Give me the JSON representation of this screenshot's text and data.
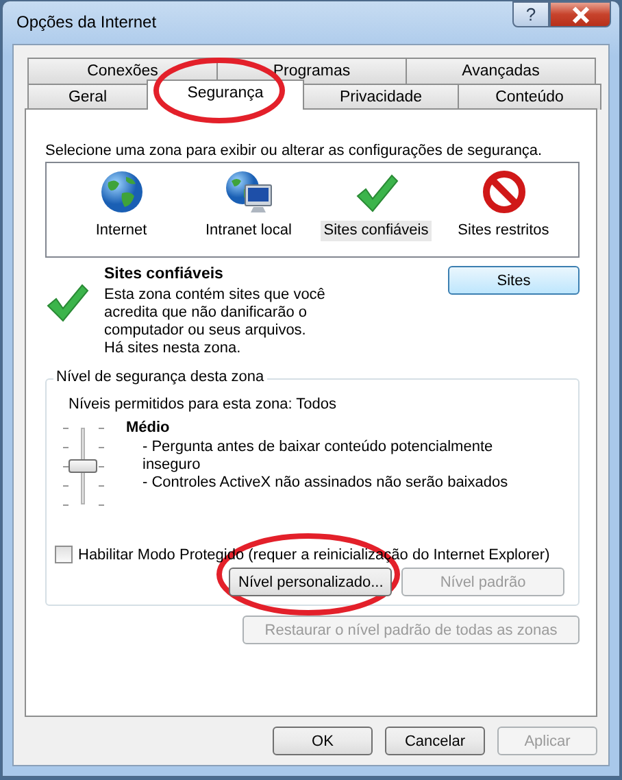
{
  "window": {
    "title": "Opções da Internet",
    "help_label": "?"
  },
  "tab_rows": [
    [
      {
        "label": "Conexões",
        "selected": false
      },
      {
        "label": "Programas",
        "selected": false
      },
      {
        "label": "Avançadas",
        "selected": false
      }
    ],
    [
      {
        "label": "Geral",
        "selected": false
      },
      {
        "label": "Segurança",
        "selected": true
      },
      {
        "label": "Privacidade",
        "selected": false
      },
      {
        "label": "Conteúdo",
        "selected": false
      }
    ]
  ],
  "instruction": "Selecione uma zona para exibir ou alterar as configurações de segurança.",
  "zones": [
    {
      "kind": "globe",
      "label": "Internet",
      "selected": false
    },
    {
      "kind": "intranet",
      "label": "Intranet local",
      "selected": false
    },
    {
      "kind": "trusted",
      "label": "Sites confiáveis",
      "selected": true
    },
    {
      "kind": "restricted",
      "label": "Sites restritos",
      "selected": false
    }
  ],
  "zone_info": {
    "kind": "trusted",
    "title": "Sites confiáveis",
    "description": [
      "Esta zona contém sites que você",
      "acredita que não danificarão o",
      "computador ou seus arquivos.",
      " Há sites nesta zona."
    ],
    "button": "Sites"
  },
  "security_level": {
    "legend": "Nível de segurança desta zona",
    "allowed": "Níveis permitidos para esta zona: Todos",
    "level": 0.5,
    "name": "Médio",
    "details": [
      "- Pergunta antes de baixar conteúdo potencialmente inseguro",
      "- Controles ActiveX não assinados não serão baixados"
    ],
    "protected_mode": {
      "label": "Habilitar Modo Protegido (requer a reinicialização do Internet Explorer)",
      "checked": false
    },
    "buttons": [
      {
        "label": "Nível personalizado...",
        "disabled": false
      },
      {
        "label": "Nível padrão",
        "disabled": true
      }
    ]
  },
  "restore_button": {
    "label": "Restaurar o nível padrão de todas as zonas",
    "disabled": true
  },
  "dialog_buttons": [
    {
      "label": "OK",
      "disabled": false
    },
    {
      "label": "Cancelar",
      "disabled": false
    },
    {
      "label": "Aplicar",
      "disabled": true
    }
  ]
}
